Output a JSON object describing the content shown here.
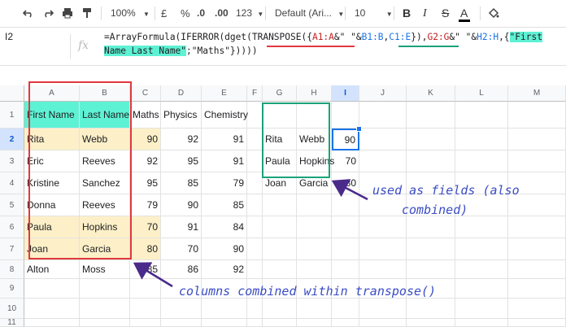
{
  "toolbar": {
    "zoom": "100%",
    "currency": "£",
    "percent": "%",
    "decimal_decrease": ".0",
    "decimal_increase": ".00",
    "number_format": "123",
    "font": "Default (Ari...",
    "font_size": "10",
    "bold": "B",
    "italic": "I",
    "strikethrough": "S",
    "text_color": "A"
  },
  "formula_bar": {
    "name_box": "I2",
    "fx": "fx",
    "formula_parts": [
      "=ArrayFormula(IFERROR(dget(TRANSPOSE({",
      "A1:A",
      "&\" \"&",
      "B1:B",
      ",",
      "C1:E",
      "}),",
      "G2:G",
      "&\" \"&",
      "H2:H",
      ",{",
      "\"First Name Last Name\"",
      ";\"Maths\"}))))"
    ]
  },
  "columns": [
    "A",
    "B",
    "C",
    "D",
    "E",
    "F",
    "G",
    "H",
    "I",
    "J",
    "K",
    "L",
    "M"
  ],
  "rows": [
    "1",
    "2",
    "3",
    "4",
    "5",
    "6",
    "7",
    "8",
    "9",
    "10",
    "11"
  ],
  "table": {
    "headers": [
      "First Name",
      "Last Name",
      "Maths",
      "Physics",
      "Chemistry"
    ],
    "data": [
      [
        "Rita",
        "Webb",
        "90",
        "92",
        "91"
      ],
      [
        "Eric",
        "Reeves",
        "92",
        "95",
        "91"
      ],
      [
        "Kristine",
        "Sanchez",
        "95",
        "85",
        "79"
      ],
      [
        "Donna",
        "Reeves",
        "79",
        "90",
        "85"
      ],
      [
        "Paula",
        "Hopkins",
        "70",
        "91",
        "84"
      ],
      [
        "Joan",
        "Garcia",
        "80",
        "70",
        "90"
      ],
      [
        "Alton",
        "Moss",
        "85",
        "86",
        "92"
      ]
    ]
  },
  "criteria": [
    [
      "Rita",
      "Webb",
      "90"
    ],
    [
      "Paula",
      "Hopkins",
      "70"
    ],
    [
      "Joan",
      "Garcia",
      "80"
    ]
  ],
  "annotations": {
    "fields": "used as fields (also",
    "fields_2": "combined)",
    "columns": "columns combined within transpose()"
  },
  "colors": {
    "red_box": "#e0393e",
    "green_box": "#1aa37a",
    "note": "#3a4cc4",
    "highlight_cyan": "#5ef2d4",
    "highlight_cream": "#fdf0c8"
  }
}
